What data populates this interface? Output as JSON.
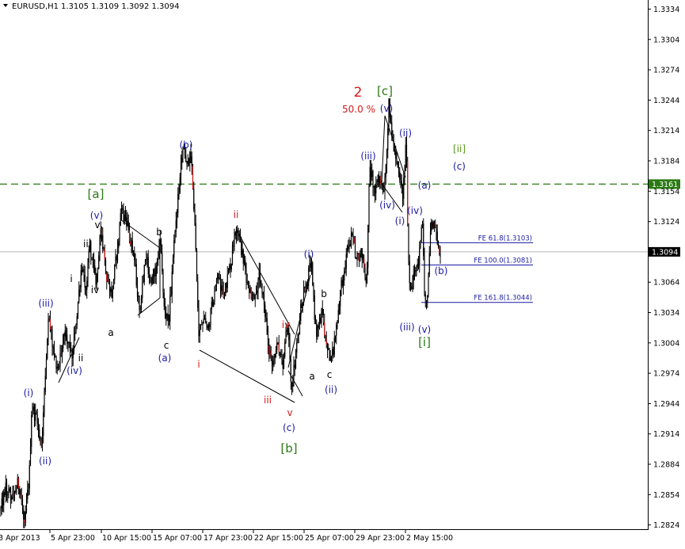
{
  "header": {
    "symbol": "EURUSD,H1",
    "ohlc": "1.3105 1.3109 1.3092 1.3094"
  },
  "colors": {
    "black": "#000000",
    "red": "#d41a1a",
    "blue": "#1a1aa0",
    "green": "#2a7a14",
    "olive": "#5a9a1a"
  },
  "chart_data": {
    "type": "candlestick",
    "y_ticks": [
      "1.3334",
      "1.3304",
      "1.3274",
      "1.3244",
      "1.3214",
      "1.3184",
      "1.3154",
      "1.3124",
      "1.3094",
      "1.3064",
      "1.3034",
      "1.3004",
      "1.2974",
      "1.2944",
      "1.2914",
      "1.2884",
      "1.2854",
      "1.2824"
    ],
    "x_ticks": [
      "3 Apr 2013",
      "5 Apr 23:00",
      "10 Apr 15:00",
      "15 Apr 07:00",
      "17 Apr 23:00",
      "22 Apr 15:00",
      "25 Apr 07:00",
      "29 Apr 23:00",
      "2 May 15:00"
    ],
    "ylim": [
      1.2819,
      1.3343
    ],
    "current_price": "1.3094",
    "level_line": {
      "value": "1.3161",
      "style": "dashed",
      "color": "#2a7a14"
    },
    "fib_extensions": [
      {
        "label": "FE 61.8(1.3103)",
        "value": 1.3103
      },
      {
        "label": "FE 100.0(1.3081)",
        "value": 1.3081
      },
      {
        "label": "FE 161.8(1.3044)",
        "value": 1.3044
      }
    ],
    "price_path": [
      {
        "t": 0,
        "p": 1.2838
      },
      {
        "t": 6,
        "p": 1.2862
      },
      {
        "t": 14,
        "p": 1.2848
      },
      {
        "t": 22,
        "p": 1.2866
      },
      {
        "t": 30,
        "p": 1.2826
      },
      {
        "t": 36,
        "p": 1.2872
      },
      {
        "t": 39,
        "p": 1.2942
      },
      {
        "t": 45,
        "p": 1.2928
      },
      {
        "t": 52,
        "p": 1.2902
      },
      {
        "t": 55,
        "p": 1.2958
      },
      {
        "t": 60,
        "p": 1.3032
      },
      {
        "t": 67,
        "p": 1.2992
      },
      {
        "t": 73,
        "p": 1.2978
      },
      {
        "t": 80,
        "p": 1.3012
      },
      {
        "t": 85,
        "p": 1.3004
      },
      {
        "t": 90,
        "p": 1.2994
      },
      {
        "t": 96,
        "p": 1.3032
      },
      {
        "t": 102,
        "p": 1.3082
      },
      {
        "t": 108,
        "p": 1.3058
      },
      {
        "t": 112,
        "p": 1.3104
      },
      {
        "t": 120,
        "p": 1.3064
      },
      {
        "t": 127,
        "p": 1.3116
      },
      {
        "t": 133,
        "p": 1.3072
      },
      {
        "t": 140,
        "p": 1.3052
      },
      {
        "t": 147,
        "p": 1.3096
      },
      {
        "t": 152,
        "p": 1.3136
      },
      {
        "t": 160,
        "p": 1.3118
      },
      {
        "t": 168,
        "p": 1.3092
      },
      {
        "t": 175,
        "p": 1.3036
      },
      {
        "t": 183,
        "p": 1.3092
      },
      {
        "t": 190,
        "p": 1.3062
      },
      {
        "t": 196,
        "p": 1.3078
      },
      {
        "t": 202,
        "p": 1.3104
      },
      {
        "t": 206,
        "p": 1.3042
      },
      {
        "t": 212,
        "p": 1.3024
      },
      {
        "t": 218,
        "p": 1.3092
      },
      {
        "t": 224,
        "p": 1.3148
      },
      {
        "t": 230,
        "p": 1.3202
      },
      {
        "t": 235,
        "p": 1.3176
      },
      {
        "t": 240,
        "p": 1.3192
      },
      {
        "t": 245,
        "p": 1.3124
      },
      {
        "t": 250,
        "p": 1.3006
      },
      {
        "t": 256,
        "p": 1.3032
      },
      {
        "t": 262,
        "p": 1.3016
      },
      {
        "t": 268,
        "p": 1.3048
      },
      {
        "t": 274,
        "p": 1.3068
      },
      {
        "t": 282,
        "p": 1.3054
      },
      {
        "t": 290,
        "p": 1.3082
      },
      {
        "t": 298,
        "p": 1.3122
      },
      {
        "t": 305,
        "p": 1.3092
      },
      {
        "t": 312,
        "p": 1.3062
      },
      {
        "t": 320,
        "p": 1.3046
      },
      {
        "t": 326,
        "p": 1.3072
      },
      {
        "t": 332,
        "p": 1.3042
      },
      {
        "t": 338,
        "p": 1.3002
      },
      {
        "t": 344,
        "p": 1.2984
      },
      {
        "t": 350,
        "p": 1.3002
      },
      {
        "t": 356,
        "p": 1.2978
      },
      {
        "t": 362,
        "p": 1.3024
      },
      {
        "t": 367,
        "p": 1.2962
      },
      {
        "t": 373,
        "p": 1.2994
      },
      {
        "t": 380,
        "p": 1.3046
      },
      {
        "t": 386,
        "p": 1.3062
      },
      {
        "t": 392,
        "p": 1.3084
      },
      {
        "t": 398,
        "p": 1.3012
      },
      {
        "t": 405,
        "p": 1.3032
      },
      {
        "t": 412,
        "p": 1.2998
      },
      {
        "t": 418,
        "p": 1.2988
      },
      {
        "t": 424,
        "p": 1.3022
      },
      {
        "t": 430,
        "p": 1.3062
      },
      {
        "t": 437,
        "p": 1.3092
      },
      {
        "t": 443,
        "p": 1.3108
      },
      {
        "t": 450,
        "p": 1.3088
      },
      {
        "t": 456,
        "p": 1.3092
      },
      {
        "t": 462,
        "p": 1.3064
      },
      {
        "t": 466,
        "p": 1.3182
      },
      {
        "t": 472,
        "p": 1.3152
      },
      {
        "t": 478,
        "p": 1.3168
      },
      {
        "t": 484,
        "p": 1.3152
      },
      {
        "t": 487,
        "p": 1.3192
      },
      {
        "t": 490,
        "p": 1.3242
      },
      {
        "t": 496,
        "p": 1.3198
      },
      {
        "t": 502,
        "p": 1.3172
      },
      {
        "t": 508,
        "p": 1.3148
      },
      {
        "t": 512,
        "p": 1.3214
      },
      {
        "t": 514,
        "p": 1.3104
      },
      {
        "t": 517,
        "p": 1.3054
      },
      {
        "t": 522,
        "p": 1.307
      },
      {
        "t": 528,
        "p": 1.3084
      },
      {
        "t": 532,
        "p": 1.3132
      },
      {
        "t": 535,
        "p": 1.3054
      },
      {
        "t": 538,
        "p": 1.3034
      },
      {
        "t": 542,
        "p": 1.3112
      },
      {
        "t": 546,
        "p": 1.3124
      },
      {
        "t": 550,
        "p": 1.3108
      },
      {
        "t": 555,
        "p": 1.3094
      }
    ],
    "lines": [
      {
        "x1": 74,
        "y1": 483,
        "x2": 100,
        "y2": 426
      },
      {
        "x1": 152,
        "y1": 277,
        "x2": 202,
        "y2": 313
      },
      {
        "x1": 174,
        "y1": 398,
        "x2": 202,
        "y2": 376
      },
      {
        "x1": 202,
        "y1": 313,
        "x2": 202,
        "y2": 376
      },
      {
        "x1": 252,
        "y1": 442,
        "x2": 372,
        "y2": 508
      },
      {
        "x1": 298,
        "y1": 289,
        "x2": 372,
        "y2": 422
      },
      {
        "x1": 364,
        "y1": 464,
        "x2": 392,
        "y2": 347
      },
      {
        "x1": 364,
        "y1": 468,
        "x2": 382,
        "y2": 500
      },
      {
        "x1": 486,
        "y1": 146,
        "x2": 512,
        "y2": 224
      },
      {
        "x1": 486,
        "y1": 146,
        "x2": 482,
        "y2": 232
      },
      {
        "x1": 482,
        "y1": 232,
        "x2": 508,
        "y2": 268
      }
    ],
    "annotations": [
      {
        "text": "2",
        "x": 452,
        "y": 122,
        "color": "red",
        "size": "huge"
      },
      {
        "text": "50.0 %",
        "x": 453,
        "y": 142,
        "color": "red",
        "size": "normal"
      },
      {
        "text": "[c]",
        "x": 486,
        "y": 120,
        "color": "green",
        "size": "big"
      },
      {
        "text": "[a]",
        "x": 121,
        "y": 250,
        "color": "green",
        "size": "big"
      },
      {
        "text": "[b]",
        "x": 365,
        "y": 571,
        "color": "green",
        "size": "big"
      },
      {
        "text": "[i]",
        "x": 536,
        "y": 437,
        "color": "green",
        "size": "big"
      },
      {
        "text": "[ii]",
        "x": 580,
        "y": 192,
        "color": "olive",
        "size": "normal"
      },
      {
        "text": "(c)",
        "x": 580,
        "y": 214,
        "color": "blue",
        "size": "normal"
      },
      {
        "text": "(v)",
        "x": 488,
        "y": 141,
        "color": "blue",
        "size": "normal"
      },
      {
        "text": "(ii)",
        "x": 512,
        "y": 172,
        "color": "blue",
        "size": "normal"
      },
      {
        "text": "(iii)",
        "x": 465,
        "y": 201,
        "color": "blue",
        "size": "normal"
      },
      {
        "text": "(a)",
        "x": 536,
        "y": 238,
        "color": "blue",
        "size": "normal"
      },
      {
        "text": "(iv)",
        "x": 524,
        "y": 270,
        "color": "blue",
        "size": "normal"
      },
      {
        "text": "(iv)",
        "x": 489,
        "y": 263,
        "color": "blue",
        "size": "normal"
      },
      {
        "text": "(i)",
        "x": 505,
        "y": 283,
        "color": "blue",
        "size": "normal"
      },
      {
        "text": "(b)",
        "x": 557,
        "y": 346,
        "color": "blue",
        "size": "normal"
      },
      {
        "text": "(iii)",
        "x": 514,
        "y": 417,
        "color": "blue",
        "size": "normal"
      },
      {
        "text": "(v)",
        "x": 536,
        "y": 420,
        "color": "blue",
        "size": "normal"
      },
      {
        "text": "(b)",
        "x": 235,
        "y": 187,
        "color": "blue",
        "size": "normal"
      },
      {
        "text": "(v)",
        "x": 122,
        "y": 276,
        "color": "blue",
        "size": "normal"
      },
      {
        "text": "v",
        "x": 123,
        "y": 288,
        "color": "black",
        "size": "small"
      },
      {
        "text": "iii",
        "x": 110,
        "y": 312,
        "color": "black",
        "size": "small"
      },
      {
        "text": "b",
        "x": 201,
        "y": 297,
        "color": "black",
        "size": "normal"
      },
      {
        "text": "i",
        "x": 90,
        "y": 356,
        "color": "black",
        "size": "small"
      },
      {
        "text": "iv",
        "x": 120,
        "y": 370,
        "color": "black",
        "size": "small"
      },
      {
        "text": "(iii)",
        "x": 58,
        "y": 387,
        "color": "blue",
        "size": "normal"
      },
      {
        "text": "a",
        "x": 140,
        "y": 424,
        "color": "black",
        "size": "normal"
      },
      {
        "text": "c",
        "x": 210,
        "y": 440,
        "color": "black",
        "size": "normal"
      },
      {
        "text": "(a)",
        "x": 208,
        "y": 456,
        "color": "blue",
        "size": "normal"
      },
      {
        "text": "ii",
        "x": 102,
        "y": 456,
        "color": "black",
        "size": "small"
      },
      {
        "text": "(iv)",
        "x": 94,
        "y": 472,
        "color": "blue",
        "size": "normal"
      },
      {
        "text": "(i)",
        "x": 36,
        "y": 500,
        "color": "blue",
        "size": "normal"
      },
      {
        "text": "(ii)",
        "x": 57,
        "y": 586,
        "color": "blue",
        "size": "normal"
      },
      {
        "text": "ii",
        "x": 298,
        "y": 275,
        "color": "red",
        "size": "normal"
      },
      {
        "text": "i",
        "x": 251,
        "y": 464,
        "color": "red",
        "size": "normal"
      },
      {
        "text": "iv",
        "x": 361,
        "y": 414,
        "color": "red",
        "size": "normal"
      },
      {
        "text": "iii",
        "x": 338,
        "y": 509,
        "color": "red",
        "size": "normal"
      },
      {
        "text": "v",
        "x": 366,
        "y": 525,
        "color": "red",
        "size": "normal"
      },
      {
        "text": "(c)",
        "x": 365,
        "y": 544,
        "color": "blue",
        "size": "normal"
      },
      {
        "text": "(i)",
        "x": 390,
        "y": 325,
        "color": "blue",
        "size": "normal"
      },
      {
        "text": "b",
        "x": 409,
        "y": 375,
        "color": "black",
        "size": "normal"
      },
      {
        "text": "a",
        "x": 394,
        "y": 479,
        "color": "black",
        "size": "normal"
      },
      {
        "text": "c",
        "x": 416,
        "y": 477,
        "color": "black",
        "size": "normal"
      },
      {
        "text": "(ii)",
        "x": 418,
        "y": 496,
        "color": "blue",
        "size": "normal"
      }
    ]
  }
}
